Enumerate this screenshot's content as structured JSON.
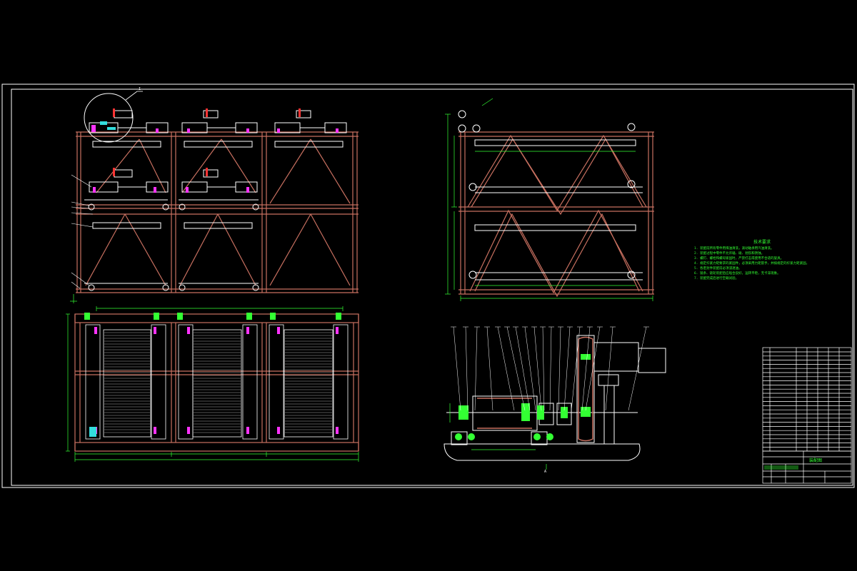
{
  "colors": {
    "background": "#000000",
    "frame": "#ffffff",
    "structure": "#c87060",
    "dimension": "#33ff33",
    "component": "#ffffff",
    "accent_magenta": "#ff33ff",
    "accent_cyan": "#33dddd",
    "accent_yellow": "#ffff00",
    "accent_red": "#ff3333"
  },
  "technical_notes": {
    "title": "技术要求",
    "lines": [
      "1. 装配前所有零件用煤油清洗，滚动轴承用汽油清洗。",
      "2. 装配过程中零件不允许磕、碰、划伤和锈蚀。",
      "3. 螺钉、螺栓和螺母紧固时，严禁打击或使用不合适的旋具。",
      "4. 规定拧紧力矩要求的紧固件，必须采用力矩扳手，并按规定的拧紧力矩紧固。",
      "5. 各密封件装配前必须浸透油。",
      "6. 链条、链轮装配后应啮合良好，运转平稳，无卡滞现象。",
      "7. 装配完成后进行空载试验。"
    ]
  },
  "title_block": {
    "drawing_name": "装配图"
  },
  "annotations": {
    "detail_marker": "I",
    "section_marker": "A"
  }
}
